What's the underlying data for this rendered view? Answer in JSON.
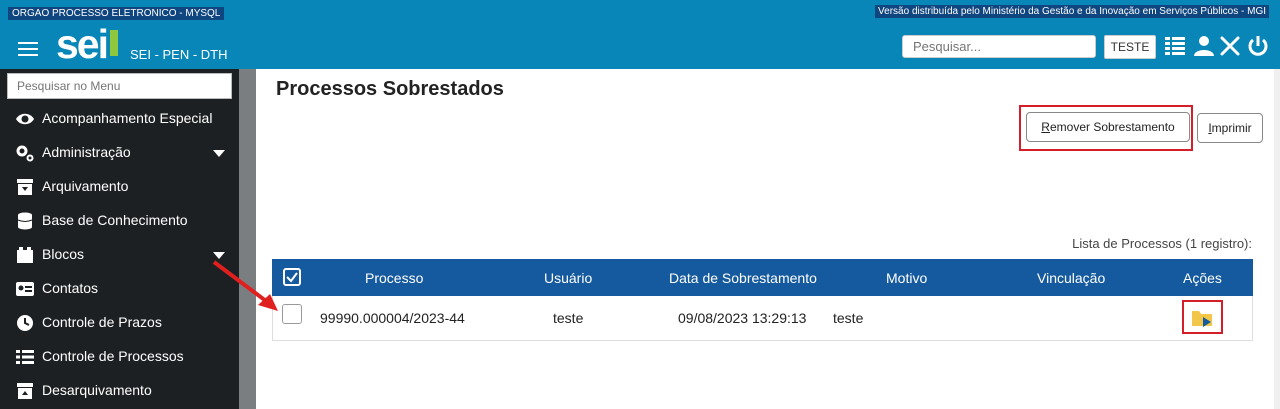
{
  "topbar": {
    "org": "ORGAO PROCESSO ELETRONICO - MYSQL",
    "version": "Versão distribuída pelo Ministério da Gestão e da Inovação em Serviços Públicos - MGI"
  },
  "header": {
    "logo": "sei",
    "system_name": "SEI - PEN - DTH",
    "search_placeholder": "Pesquisar...",
    "unit_button": "TESTE",
    "icons": [
      "menu-grid-icon",
      "user-icon",
      "tools-icon",
      "power-icon"
    ]
  },
  "sidebar": {
    "search_placeholder": "Pesquisar no Menu",
    "items": [
      {
        "label": "Acompanhamento Especial",
        "icon": "eye-icon"
      },
      {
        "label": "Administração",
        "icon": "gears-icon",
        "has_submenu": true
      },
      {
        "label": "Arquivamento",
        "icon": "archive-icon"
      },
      {
        "label": "Base de Conhecimento",
        "icon": "database-icon"
      },
      {
        "label": "Blocos",
        "icon": "blocks-icon",
        "has_submenu": true
      },
      {
        "label": "Contatos",
        "icon": "contact-card-icon"
      },
      {
        "label": "Controle de Prazos",
        "icon": "clock-icon"
      },
      {
        "label": "Controle de Processos",
        "icon": "list-icon"
      },
      {
        "label": "Desarquivamento",
        "icon": "unarchive-icon"
      }
    ]
  },
  "main": {
    "title": "Processos Sobrestados",
    "buttons": {
      "remove": "Remover Sobrestamento",
      "remove_accesskey": "R",
      "remove_rest": "emover Sobrestamento",
      "print": "Imprimir",
      "print_accesskey": "I",
      "print_rest": "mprimir"
    },
    "list_caption": "Lista de Processos (1 registro):",
    "table": {
      "columns": [
        "Processo",
        "Usuário",
        "Data de Sobrestamento",
        "Motivo",
        "Vinculação",
        "Ações"
      ],
      "rows": [
        {
          "processo": "99990.000004/2023-44",
          "usuario": "teste",
          "data": "09/08/2023 13:29:13",
          "motivo": "teste",
          "vinculacao": "",
          "action_icon": "folder-play-icon"
        }
      ]
    }
  },
  "colors": {
    "header_blue": "#0886b8",
    "table_header": "#155a9e",
    "highlight_red": "#d41f2a",
    "sidebar": "#1d2023"
  }
}
